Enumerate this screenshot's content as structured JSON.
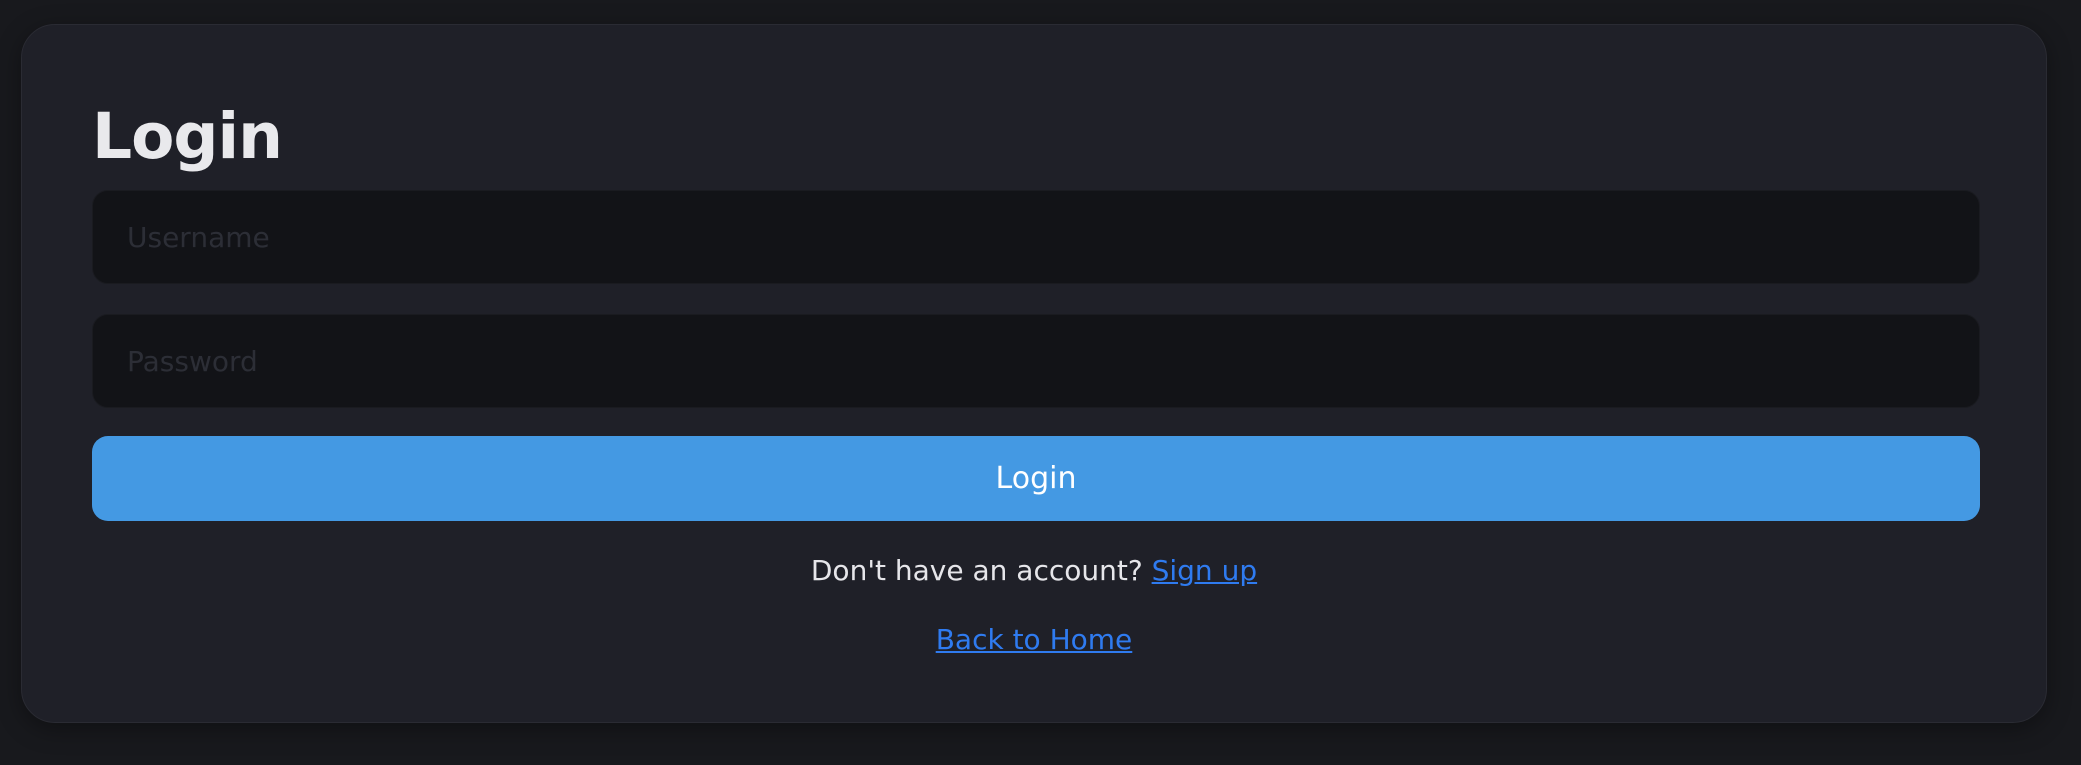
{
  "form": {
    "title": "Login",
    "username_placeholder": "Username",
    "username_value": "",
    "password_placeholder": "Password",
    "password_value": "",
    "submit_label": "Login",
    "signup_prompt": "Don't have an account?",
    "signup_link_label": "Sign up",
    "home_link_label": "Back to Home"
  },
  "colors": {
    "page_background": "#18191d",
    "card_background": "#1f2028",
    "input_background": "#121317",
    "button_background": "#4499e3",
    "link_color": "#2f7bf0",
    "text_color": "#e9e9ec"
  }
}
